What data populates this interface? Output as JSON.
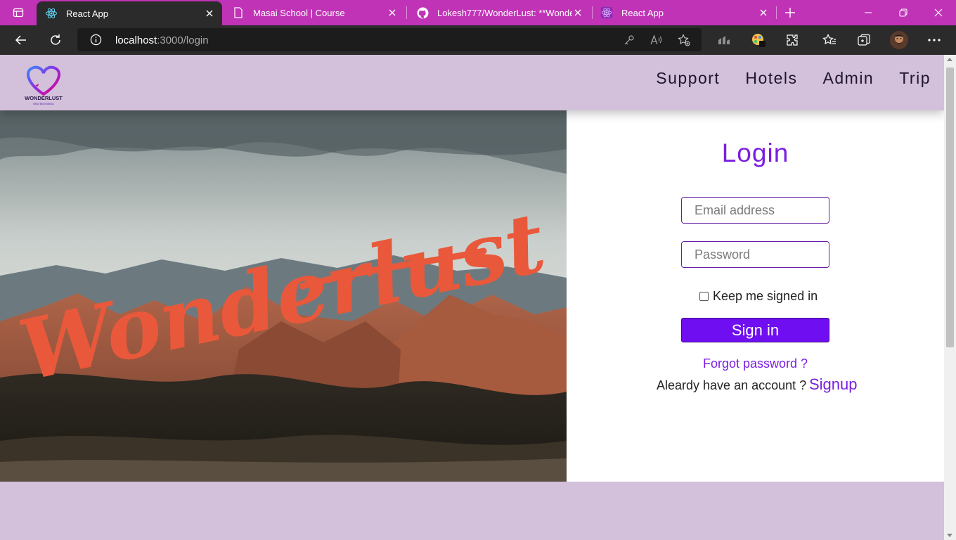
{
  "browser": {
    "tabs": [
      {
        "title": "React App",
        "active": true
      },
      {
        "title": "Masai School | Course",
        "active": false
      },
      {
        "title": "Lokesh777/WonderLust: **Wonde",
        "active": false
      },
      {
        "title": "React App",
        "active": false
      }
    ],
    "url_host": "localhost",
    "url_path": ":3000/login"
  },
  "nav": {
    "logo_text": "WONDERLUST",
    "logo_tagline": "NEW BEGINNING",
    "links": [
      "Support",
      "Hotels",
      "Admin",
      "Trip"
    ]
  },
  "hero": {
    "brand_script": "Wonderlust"
  },
  "login": {
    "title": "Login",
    "email_placeholder": "Email address",
    "password_placeholder": "Password",
    "keep_signed_in": "Keep me signed in",
    "signin_label": "Sign in",
    "forgot_label": "Forgot password ?",
    "have_account_label": "Aleardy have an account ?",
    "signup_label": "Signup"
  },
  "colors": {
    "accent": "#7a1fdf",
    "button": "#6f0ef0",
    "navbar_bg": "#d3c0da",
    "tabstrip": "#c033b6",
    "hero_script": "#e9583a"
  }
}
